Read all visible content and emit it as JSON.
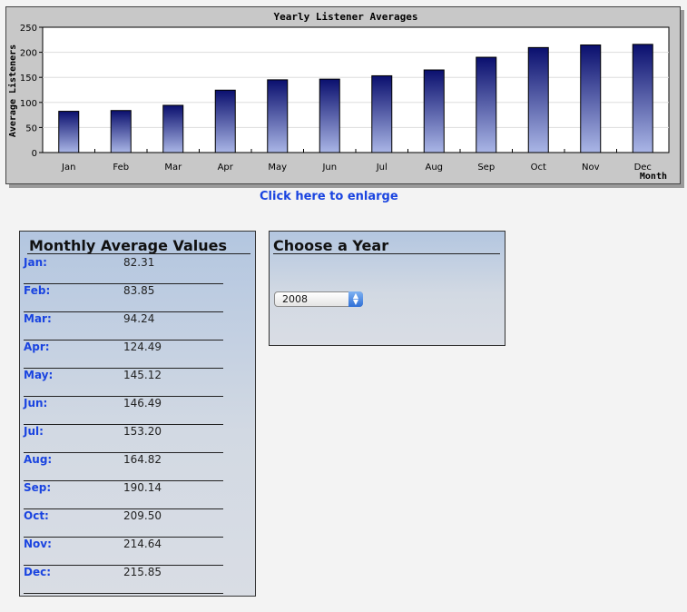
{
  "chart_data": {
    "type": "bar",
    "title": "Yearly Listener Averages",
    "xlabel": "Month",
    "ylabel": "Average Listeners",
    "ylim": [
      0,
      250
    ],
    "yticks": [
      "0",
      "50",
      "100",
      "150",
      "200",
      "250"
    ],
    "grid": true,
    "categories": [
      "Jan",
      "Feb",
      "Mar",
      "Apr",
      "May",
      "Jun",
      "Jul",
      "Aug",
      "Sep",
      "Oct",
      "Nov",
      "Dec"
    ],
    "values": [
      82.31,
      83.85,
      94.24,
      124.49,
      145.12,
      146.49,
      153.2,
      164.82,
      190.14,
      209.5,
      214.64,
      215.85
    ],
    "colors": {
      "bar_top": "#0a0f6e",
      "bar_bottom": "#aab6e6",
      "plot_bg": "#ffffff",
      "frame_bg": "#c8c8c8"
    }
  },
  "enlarge_link": "Click here to enlarge",
  "monthly_panel": {
    "title": "Monthly Average Values",
    "rows": [
      {
        "month": "Jan:",
        "value": "82.31"
      },
      {
        "month": "Feb:",
        "value": "83.85"
      },
      {
        "month": "Mar:",
        "value": "94.24"
      },
      {
        "month": "Apr:",
        "value": "124.49"
      },
      {
        "month": "May:",
        "value": "145.12"
      },
      {
        "month": "Jun:",
        "value": "146.49"
      },
      {
        "month": "Jul:",
        "value": "153.20"
      },
      {
        "month": "Aug:",
        "value": "164.82"
      },
      {
        "month": "Sep:",
        "value": "190.14"
      },
      {
        "month": "Oct:",
        "value": "209.50"
      },
      {
        "month": "Nov:",
        "value": "214.64"
      },
      {
        "month": "Dec:",
        "value": "215.85"
      }
    ]
  },
  "year_panel": {
    "title": "Choose a Year",
    "selected_year": "2008",
    "select_arrow_icon": "updown-arrows-icon"
  }
}
